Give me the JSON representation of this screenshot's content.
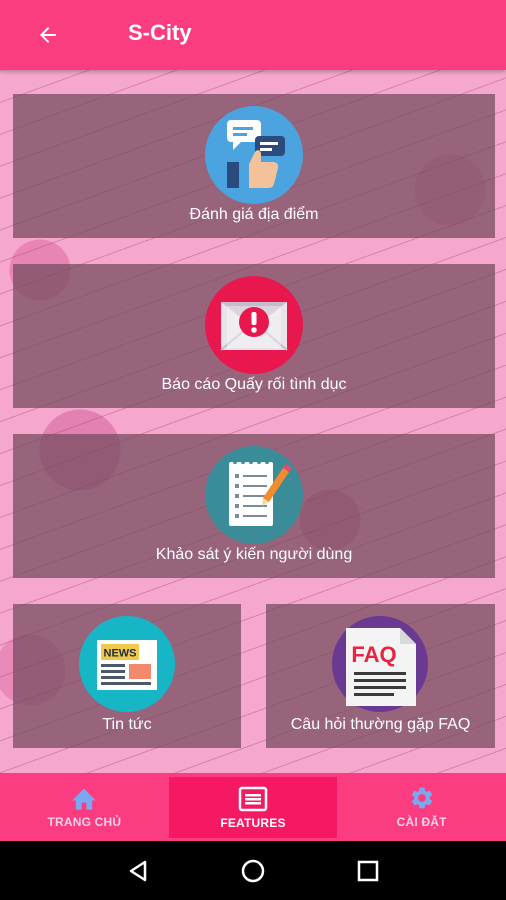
{
  "app": {
    "title": "S-City",
    "colors": {
      "primary": "#fb3c80",
      "active_tab": "#f51964",
      "card_overlay": "#734b5c"
    }
  },
  "header": {
    "back_icon": "arrow-left-icon"
  },
  "features": [
    {
      "label": "Đánh giá địa điểm",
      "icon": "review-chat-thumbsup-icon"
    },
    {
      "label": "Báo cáo Quấy rối tình dục",
      "icon": "report-alert-icon"
    },
    {
      "label": "Khảo sát ý kiến người dùng",
      "icon": "survey-notepad-icon"
    },
    {
      "label": "Tin tức",
      "icon": "news-icon",
      "icon_text": "NEWS"
    },
    {
      "label": "Câu hỏi thường gặp FAQ",
      "icon": "faq-icon",
      "icon_text": "FAQ"
    }
  ],
  "bottom_nav": [
    {
      "label": "TRANG CHỦ",
      "icon": "home-icon",
      "active": false
    },
    {
      "label": "FEATURES",
      "icon": "features-list-icon",
      "active": true
    },
    {
      "label": "CÀI ĐẶT",
      "icon": "gear-icon",
      "active": false
    }
  ],
  "system_nav": [
    "back-triangle-icon",
    "home-circle-icon",
    "recents-square-icon"
  ]
}
